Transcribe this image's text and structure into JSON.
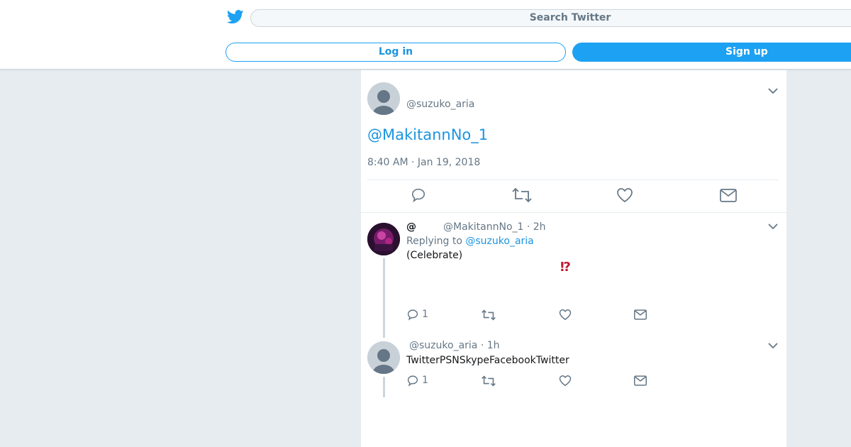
{
  "header": {
    "search_placeholder": "Search Twitter",
    "login_label": "Log in",
    "signup_label": "Sign up"
  },
  "main_tweet": {
    "handle": "@suzuko_aria",
    "text": "@MakitannNo_1",
    "timestamp": "8:40 AM · Jan 19, 2018"
  },
  "replies": [
    {
      "name": "@",
      "handle_time": "@MakitannNo_1 · 2h",
      "replying_prefix": "Replying to",
      "replying_to": "@suzuko_aria",
      "text": "(Celebrate)",
      "emoji": "⁉",
      "reply_count": "1"
    },
    {
      "handle_time": "@suzuko_aria · 1h",
      "text": "TwitterPSNSkypeFacebookTwitter",
      "reply_count": "1"
    }
  ],
  "colors": {
    "brand": "#1da1f2",
    "link": "#1b95e0",
    "muted": "#657786",
    "background": "#e6ecf0"
  }
}
